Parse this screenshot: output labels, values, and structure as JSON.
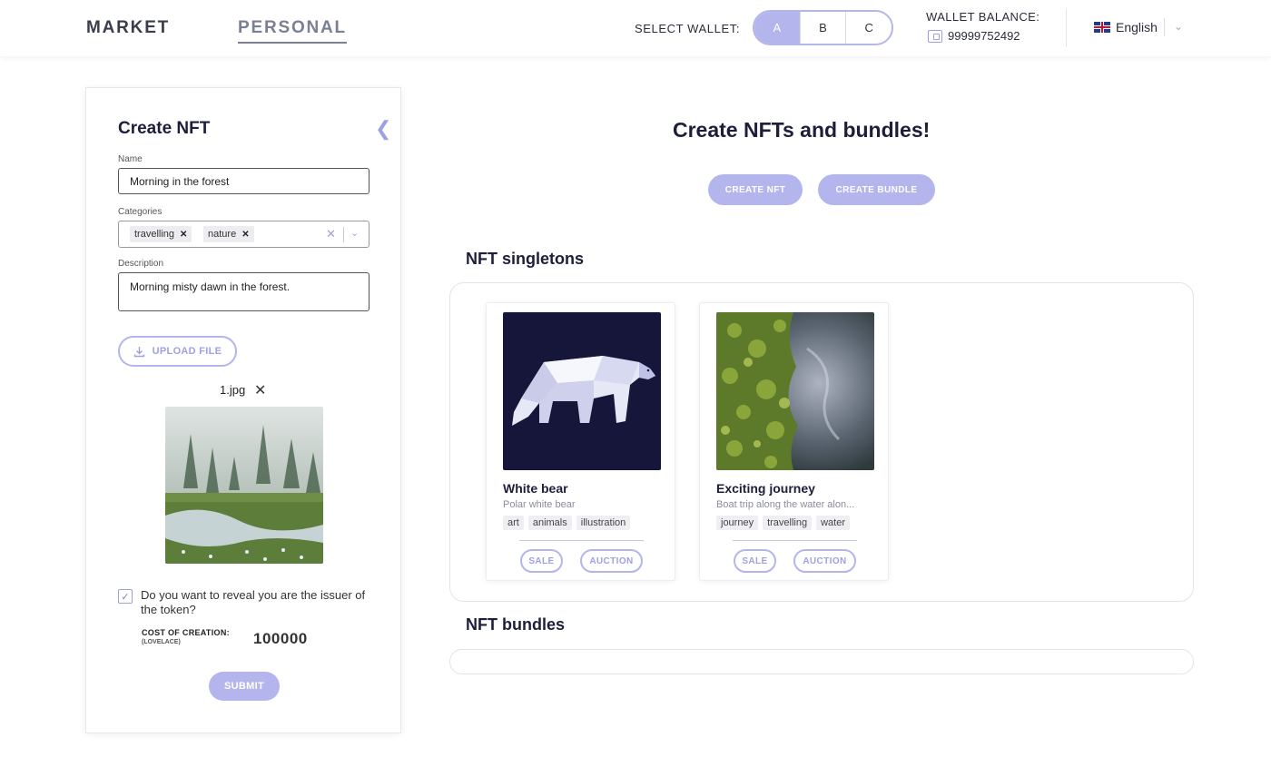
{
  "header": {
    "nav": {
      "market": "MARKET",
      "personal": "PERSONAL"
    },
    "wallet_select_label": "SELECT WALLET:",
    "wallet_options": [
      "A",
      "B",
      "C"
    ],
    "wallet_selected": "A",
    "balance_label": "WALLET BALANCE:",
    "balance_value": "99999752492",
    "language": "English"
  },
  "create_panel": {
    "title": "Create NFT",
    "name_label": "Name",
    "name_value": "Morning in the forest",
    "categories_label": "Categories",
    "categories": [
      "travelling",
      "nature"
    ],
    "description_label": "Description",
    "description_value": "Morning misty dawn in the forest.",
    "upload_label": "UPLOAD FILE",
    "file_name": "1.jpg",
    "reveal_checked": true,
    "reveal_text": "Do you want to reveal you are the issuer of the token?",
    "cost_label": "COST OF CREATION:",
    "cost_unit": "(LOVELACE)",
    "cost_value": "100000",
    "submit_label": "SUBMIT"
  },
  "main": {
    "title": "Create NFTs and bundles!",
    "create_nft_label": "CREATE NFT",
    "create_bundle_label": "CREATE BUNDLE",
    "singletons_title": "NFT singletons",
    "bundles_title": "NFT bundles",
    "cards": [
      {
        "title": "White bear",
        "description": "Polar white bear",
        "tags": [
          "art",
          "animals",
          "illustration"
        ],
        "sale_label": "SALE",
        "auction_label": "AUCTION"
      },
      {
        "title": "Exciting journey",
        "description": "Boat trip along the water alon...",
        "tags": [
          "journey",
          "travelling",
          "water"
        ],
        "sale_label": "SALE",
        "auction_label": "AUCTION"
      }
    ]
  },
  "colors": {
    "accent": "#b3b5ec",
    "accent_text": "#9ea1e0",
    "heading": "#1b1f3b"
  }
}
